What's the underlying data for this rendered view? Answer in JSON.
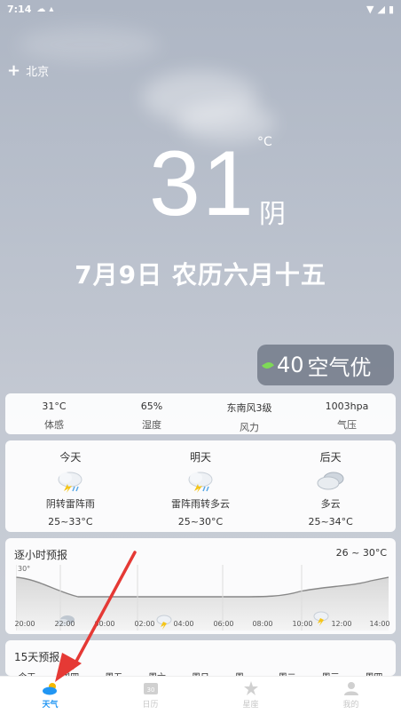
{
  "status_bar": {
    "time": "7:14"
  },
  "city": "北京",
  "current": {
    "temp": "31",
    "unit": "°C",
    "condition": "阴"
  },
  "date_line": "7月9日 农历六月十五",
  "aqi": {
    "value": "40",
    "label": "空气优"
  },
  "details": [
    {
      "value": "31°C",
      "label": "体感"
    },
    {
      "value": "65%",
      "label": "湿度"
    },
    {
      "value": "东南风3级",
      "label": "风力"
    },
    {
      "value": "1003hpa",
      "label": "气压"
    }
  ],
  "days": [
    {
      "name": "今天",
      "desc": "阴转雷阵雨",
      "range": "25~33°C",
      "icon": "thunder-cloud-icon"
    },
    {
      "name": "明天",
      "desc": "雷阵雨转多云",
      "range": "25~30°C",
      "icon": "thunder-cloud-icon"
    },
    {
      "name": "后天",
      "desc": "多云",
      "range": "25~34°C",
      "icon": "cloudy-icon"
    }
  ],
  "hourly": {
    "title": "逐小时预报",
    "range": "26 ~ 30°C",
    "axis_top": "30°",
    "hours": [
      "20:00",
      "22:00",
      "00:00",
      "02:00",
      "04:00",
      "06:00",
      "08:00",
      "10:00",
      "12:00",
      "14:00"
    ]
  },
  "fifteen": {
    "title": "15天预报",
    "weekdays": [
      "今天",
      "周四",
      "周五",
      "周六",
      "周日",
      "周一",
      "周二",
      "周三",
      "周四"
    ]
  },
  "nav": [
    {
      "label": "天气",
      "icon": "weather-icon",
      "active": true
    },
    {
      "label": "日历",
      "icon": "calendar-icon",
      "active": false
    },
    {
      "label": "星座",
      "icon": "star-icon",
      "active": false
    },
    {
      "label": "我的",
      "icon": "profile-icon",
      "active": false
    }
  ],
  "colors": {
    "accent": "#2196f3",
    "leaf": "#7ed957",
    "arrow": "#e53935"
  }
}
